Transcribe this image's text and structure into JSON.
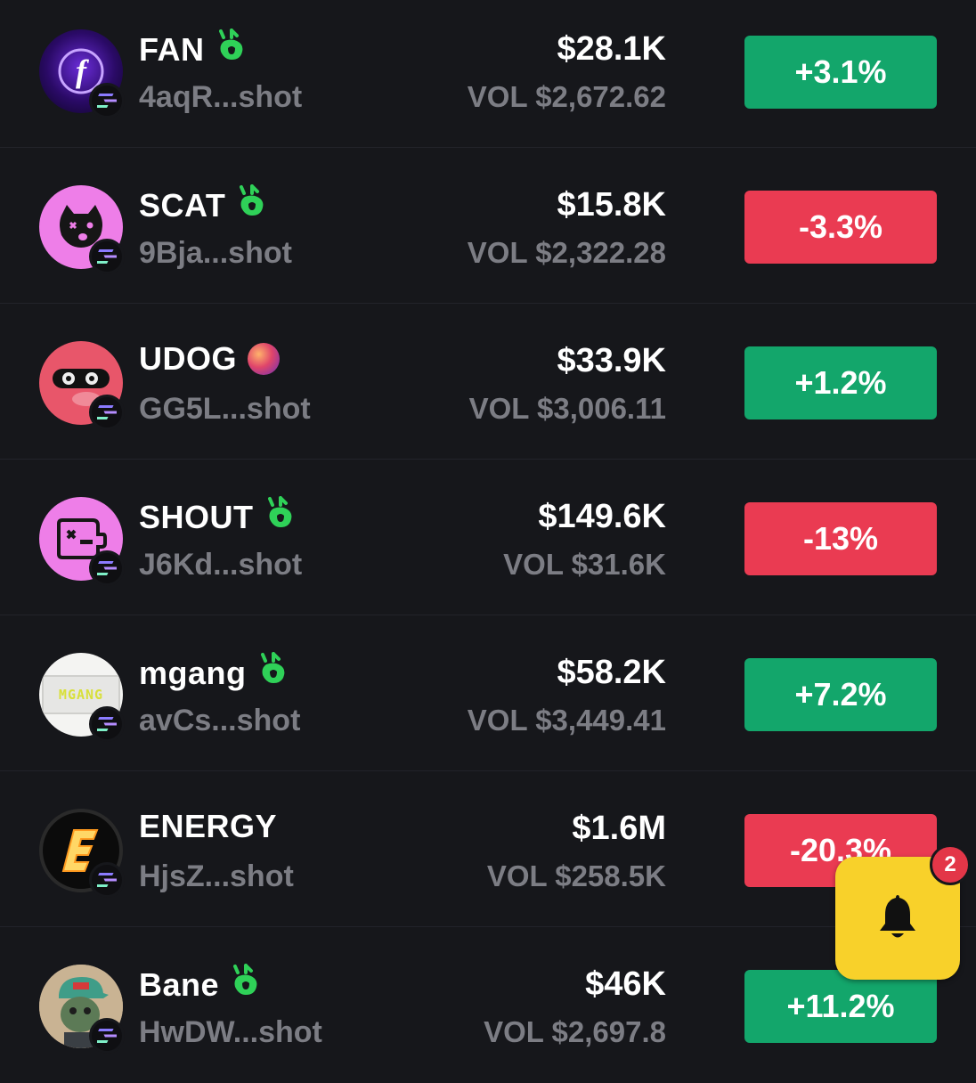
{
  "tokens": [
    {
      "symbol": "FAN",
      "address": "4aqR...shot",
      "price": "$28.1K",
      "volume": "VOL $2,672.62",
      "change": "+3.1%",
      "direction": "up",
      "tag_icon": "bonk-icon",
      "avatar_icon": "fan-logo"
    },
    {
      "symbol": "SCAT",
      "address": "9Bja...shot",
      "price": "$15.8K",
      "volume": "VOL $2,322.28",
      "change": "-3.3%",
      "direction": "down",
      "tag_icon": "bonk-icon",
      "avatar_icon": "cat-logo"
    },
    {
      "symbol": "UDOG",
      "address": "GG5L...shot",
      "price": "$33.9K",
      "volume": "VOL $3,006.11",
      "change": "+1.2%",
      "direction": "up",
      "tag_icon": "orb-icon",
      "avatar_icon": "dog-logo"
    },
    {
      "symbol": "SHOUT",
      "address": "J6Kd...shot",
      "price": "$149.6K",
      "volume": "VOL $31.6K",
      "change": "-13%",
      "direction": "down",
      "tag_icon": "bonk-icon",
      "avatar_icon": "shout-logo"
    },
    {
      "symbol": "mgang",
      "address": "avCs...shot",
      "price": "$58.2K",
      "volume": "VOL $3,449.41",
      "change": "+7.2%",
      "direction": "up",
      "tag_icon": "bonk-icon",
      "avatar_icon": "mgang-logo",
      "avatar_text": "MGANG"
    },
    {
      "symbol": "ENERGY",
      "address": "HjsZ...shot",
      "price": "$1.6M",
      "volume": "VOL $258.5K",
      "change": "-20.3%",
      "direction": "down",
      "tag_icon": "",
      "avatar_icon": "energy-logo"
    },
    {
      "symbol": "Bane",
      "address": "HwDW...shot",
      "price": "$46K",
      "volume": "VOL $2,697.8",
      "change": "+11.2%",
      "direction": "up",
      "tag_icon": "bonk-icon",
      "avatar_icon": "bane-logo"
    }
  ],
  "notifications": {
    "count": "2",
    "icon": "bell-icon"
  },
  "colors": {
    "up": "#13a66b",
    "down": "#ea3b52",
    "bell": "#f8d12a",
    "tag": "#2fd158"
  }
}
